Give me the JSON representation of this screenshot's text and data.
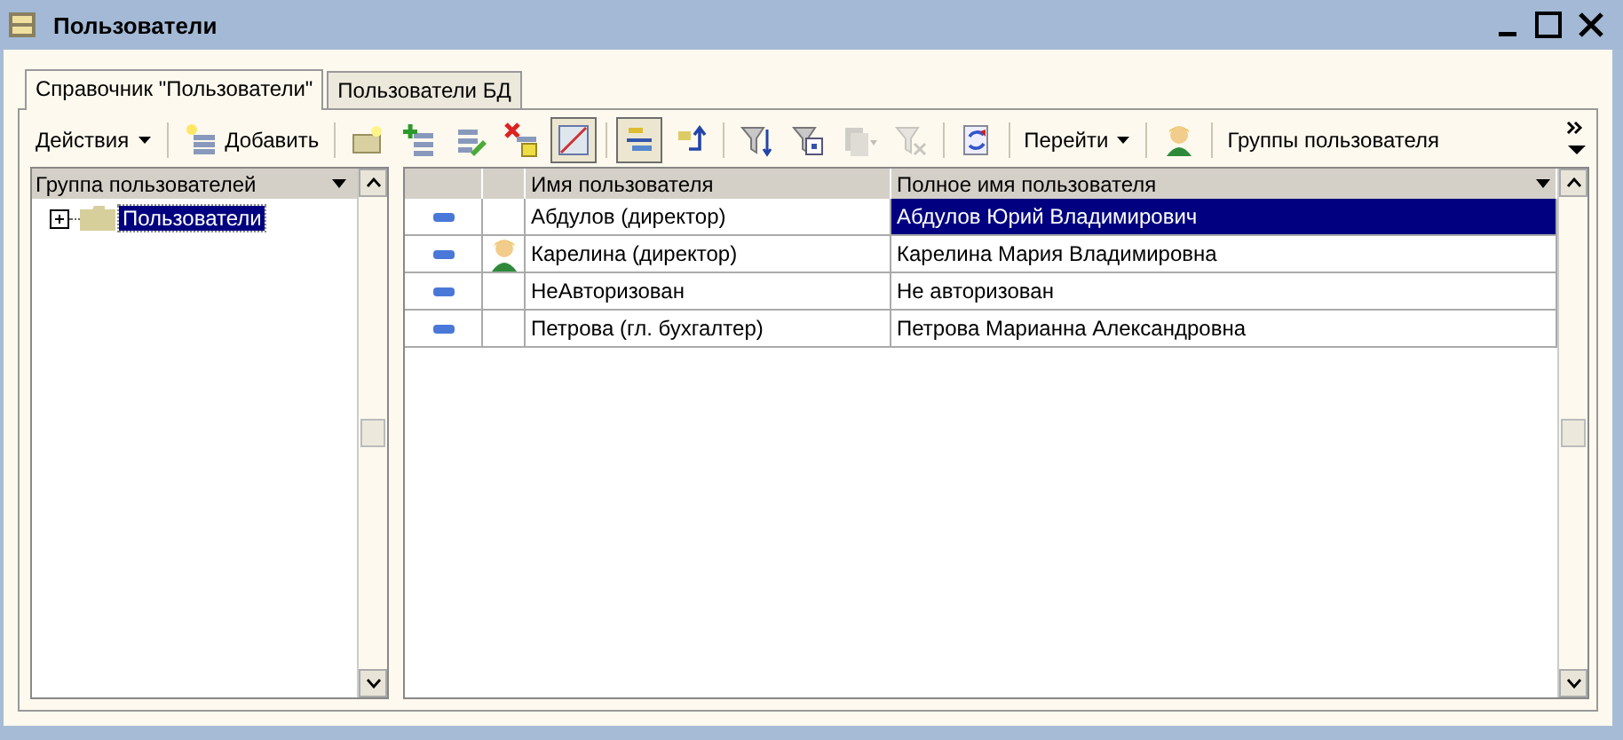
{
  "window": {
    "title": "Пользователи"
  },
  "tabs": [
    {
      "label": "Справочник \"Пользователи\"",
      "selected": true
    },
    {
      "label": "Пользователи БД",
      "selected": false
    }
  ],
  "toolbar": [
    {
      "kind": "menu",
      "label": "Действия"
    },
    {
      "kind": "separator"
    },
    {
      "kind": "button",
      "label": "Добавить"
    },
    {
      "kind": "separator"
    },
    {
      "kind": "icon",
      "pressed": false,
      "disabled": false
    },
    {
      "kind": "icon",
      "pressed": false,
      "disabled": false
    },
    {
      "kind": "icon",
      "pressed": false,
      "disabled": false
    },
    {
      "kind": "icon",
      "pressed": false,
      "disabled": false
    },
    {
      "kind": "icon",
      "pressed": true,
      "disabled": false
    },
    {
      "kind": "separator"
    },
    {
      "kind": "icon",
      "pressed": true,
      "disabled": false
    },
    {
      "kind": "icon",
      "pressed": false,
      "disabled": false
    },
    {
      "kind": "separator"
    },
    {
      "kind": "icon",
      "pressed": false,
      "disabled": false
    },
    {
      "kind": "icon",
      "pressed": false,
      "disabled": false
    },
    {
      "kind": "icon",
      "pressed": false,
      "disabled": true
    },
    {
      "kind": "icon",
      "pressed": false,
      "disabled": true
    },
    {
      "kind": "separator"
    },
    {
      "kind": "icon",
      "pressed": false,
      "disabled": false
    },
    {
      "kind": "separator"
    },
    {
      "kind": "menu",
      "label": "Перейти"
    },
    {
      "kind": "separator"
    },
    {
      "kind": "icon",
      "pressed": false,
      "disabled": false
    },
    {
      "kind": "separator"
    },
    {
      "kind": "text",
      "label": "Группы пользователя"
    }
  ],
  "tree": {
    "header": "Группа пользователей",
    "items": [
      {
        "label": "Пользователи",
        "selected": true,
        "expanded": false
      }
    ]
  },
  "table": {
    "columns": [
      "Имя пользователя",
      "Полное имя пользователя"
    ],
    "rows": [
      {
        "name": "Абдулов (директор)",
        "full_name": "Абдулов Юрий Владимирович",
        "selected": true,
        "has_avatar": false
      },
      {
        "name": "Карелина (директор)",
        "full_name": "Карелина Мария Владимировна",
        "selected": false,
        "has_avatar": true
      },
      {
        "name": "НеАвторизован",
        "full_name": "Не авторизован",
        "selected": false,
        "has_avatar": false
      },
      {
        "name": "Петрова (гл. бухгалтер)",
        "full_name": "Петрова Марианна Александровна",
        "selected": false,
        "has_avatar": false
      }
    ]
  }
}
